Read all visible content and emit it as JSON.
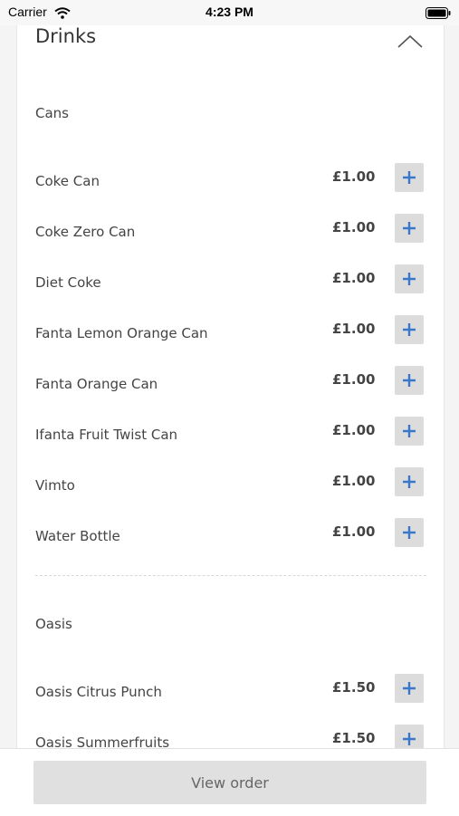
{
  "status_bar": {
    "carrier": "Carrier",
    "time": "4:23 PM"
  },
  "menu": {
    "title": "Drinks",
    "sections": [
      {
        "label": "Cans",
        "items": [
          {
            "name": "Coke Can",
            "price": "£1.00"
          },
          {
            "name": "Coke Zero Can",
            "price": "£1.00"
          },
          {
            "name": "Diet Coke",
            "price": "£1.00"
          },
          {
            "name": "Fanta Lemon Orange Can",
            "price": "£1.00"
          },
          {
            "name": "Fanta Orange Can",
            "price": "£1.00"
          },
          {
            "name": "Ifanta Fruit Twist Can",
            "price": "£1.00"
          },
          {
            "name": "Vimto",
            "price": "£1.00"
          },
          {
            "name": "Water Bottle",
            "price": "£1.00"
          }
        ]
      },
      {
        "label": "Oasis",
        "items": [
          {
            "name": "Oasis Citrus Punch",
            "price": "£1.50"
          },
          {
            "name": "Oasis Summerfruits",
            "price": "£1.50"
          }
        ]
      }
    ]
  },
  "footer": {
    "view_order_label": "View order"
  },
  "colors": {
    "accent": "#3a78c9",
    "button_bg": "#dcdcdc"
  },
  "icons": {
    "add": "plus-icon",
    "collapse": "chevron-up-icon"
  }
}
